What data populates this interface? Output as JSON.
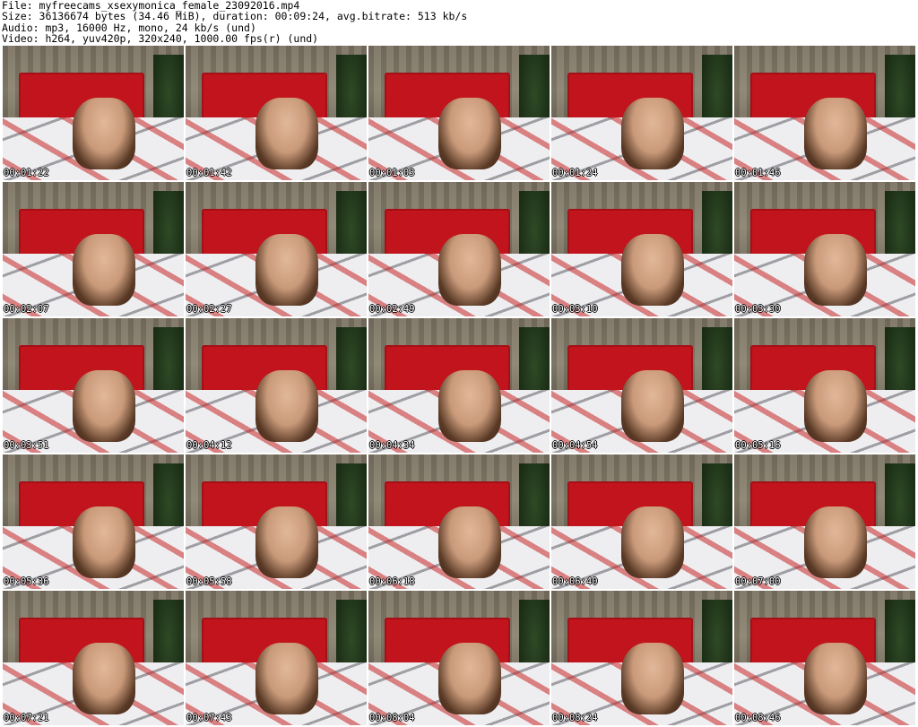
{
  "header": {
    "file_line": "File: myfreecams_xsexymonica_female_23092016.mp4",
    "size_line": "Size: 36136674 bytes (34.46 MiB), duration: 00:09:24, avg.bitrate: 513 kb/s",
    "audio_line": "Audio: mp3, 16000 Hz, mono, 24 kb/s (und)",
    "video_line": "Video: h264, yuv420p, 320x240, 1000.00 fps(r) (und)"
  },
  "thumbnails": [
    {
      "timestamp": "00:01:22"
    },
    {
      "timestamp": "00:01:42"
    },
    {
      "timestamp": "00:01:03"
    },
    {
      "timestamp": "00:01:24"
    },
    {
      "timestamp": "00:01:46"
    },
    {
      "timestamp": "00:02:07"
    },
    {
      "timestamp": "00:02:27"
    },
    {
      "timestamp": "00:02:49"
    },
    {
      "timestamp": "00:03:10"
    },
    {
      "timestamp": "00:03:30"
    },
    {
      "timestamp": "00:03:51"
    },
    {
      "timestamp": "00:04:12"
    },
    {
      "timestamp": "00:04:34"
    },
    {
      "timestamp": "00:04:54"
    },
    {
      "timestamp": "00:05:16"
    },
    {
      "timestamp": "00:05:36"
    },
    {
      "timestamp": "00:05:58"
    },
    {
      "timestamp": "00:06:18"
    },
    {
      "timestamp": "00:06:40"
    },
    {
      "timestamp": "00:07:00"
    },
    {
      "timestamp": "00:07:21"
    },
    {
      "timestamp": "00:07:43"
    },
    {
      "timestamp": "00:08:04"
    },
    {
      "timestamp": "00:08:24"
    },
    {
      "timestamp": "00:08:46"
    }
  ]
}
